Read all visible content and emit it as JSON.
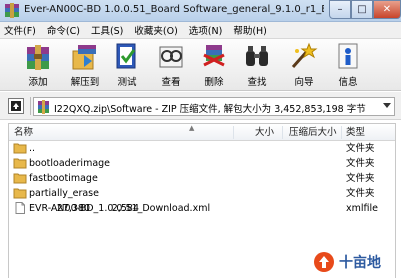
{
  "window": {
    "title": "Ever-AN00C-BD 1.0.0.51_Board Software_general_9.1.0_r1_E...",
    "minimize": "–",
    "maximize": "□",
    "close": "✕"
  },
  "menu": [
    "文件(F)",
    "命令(C)",
    "工具(S)",
    "收藏夹(O)",
    "选项(N)",
    "帮助(H)"
  ],
  "toolbar": [
    {
      "label": "添加",
      "icon": "add-archive-icon"
    },
    {
      "label": "解压到",
      "icon": "extract-to-icon"
    },
    {
      "label": "测试",
      "icon": "test-icon"
    },
    {
      "label": "查看",
      "icon": "view-icon"
    },
    {
      "label": "删除",
      "icon": "delete-icon"
    },
    {
      "label": "查找",
      "icon": "find-icon"
    },
    {
      "label": "向导",
      "icon": "wizard-icon"
    },
    {
      "label": "信息",
      "icon": "info-icon"
    }
  ],
  "address": {
    "path": "I22QXQ.zip\\Software - ZIP 压缩文件, 解包大小为 3,452,853,198 字节"
  },
  "columns": {
    "name": "名称",
    "size": "大小",
    "packed": "压缩后大小",
    "type": "类型"
  },
  "files": [
    {
      "name": "..",
      "size": "",
      "packed": "",
      "type": "文件夹",
      "kind": "folder"
    },
    {
      "name": "bootloaderimage",
      "size": "",
      "packed": "",
      "type": "文件夹",
      "kind": "folder"
    },
    {
      "name": "fastbootimage",
      "size": "",
      "packed": "",
      "type": "文件夹",
      "kind": "folder"
    },
    {
      "name": "partially_erase",
      "size": "",
      "packed": "",
      "type": "文件夹",
      "kind": "folder"
    },
    {
      "name": "EVR-AN00-BD_1.0.0.51_Download.xml",
      "size": "27,380",
      "packed": "2,584",
      "type": "xmlfile",
      "kind": "file"
    }
  ],
  "watermark": {
    "text": "十亩地"
  },
  "colors": {
    "folder": "#e8b84a",
    "titlebar": "#b9d0ea",
    "close": "#c8442a"
  }
}
